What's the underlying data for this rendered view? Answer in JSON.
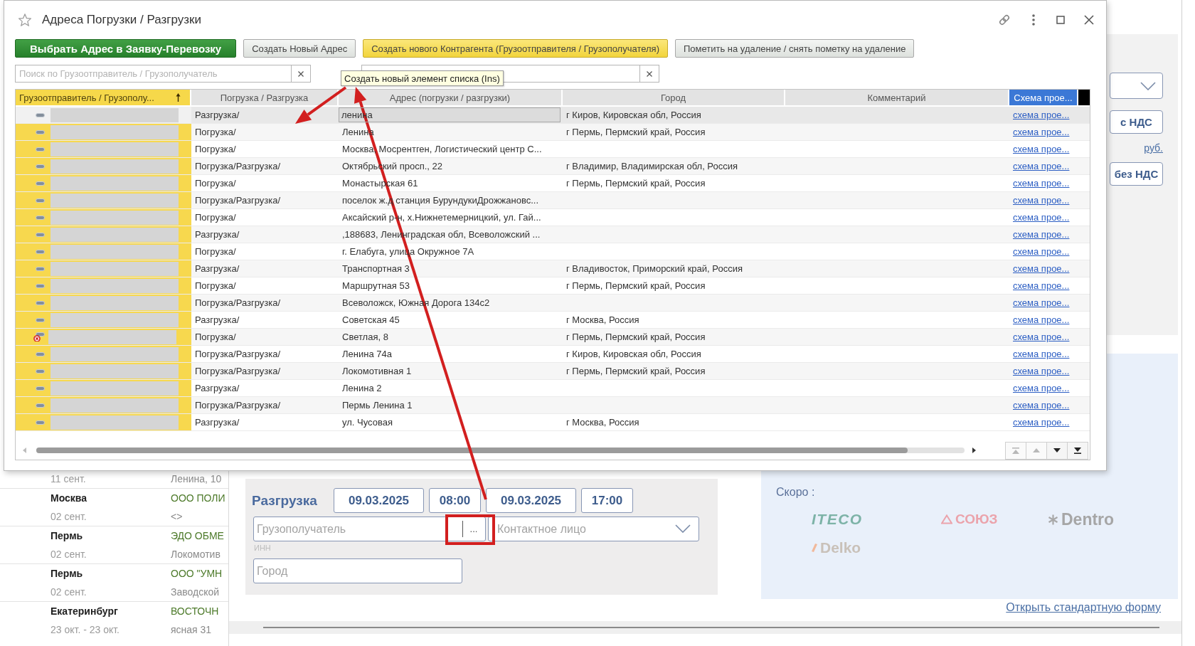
{
  "dialog": {
    "title": "Адреса Погрузки / Разгрузки",
    "favorite": false,
    "toolbar": [
      {
        "label": "Выбрать Адрес в Заявку-Перевозку",
        "kind": "primary"
      },
      {
        "label": "Создать Новый Адрес",
        "kind": "plain"
      },
      {
        "label": "Создать нового Контрагента (Грузоотправителя / Грузополучателя)",
        "kind": "accent"
      },
      {
        "label": "Пометить на удаление / снять пометку на удаление",
        "kind": "plain"
      }
    ],
    "search_fields": [
      {
        "placeholder": "Поиск по Грузоотправитель / Грузополучатель",
        "clear_button": true
      },
      {
        "clear_button": true
      }
    ],
    "tooltip": {
      "text": "Создать новый элемент списка (Ins)"
    },
    "table": {
      "columns": [
        {
          "label": "Грузоотправитель / Грузополу...",
          "kind": "name",
          "sorted": true,
          "highlighted": false
        },
        {
          "label": "Погрузка / Разгрузка",
          "kind": "type",
          "sorted": false,
          "highlighted": false
        },
        {
          "label": "Адрес (погрузки / разгрузки)",
          "kind": "address",
          "sorted": false,
          "highlighted": false
        },
        {
          "label": "Город",
          "kind": "city",
          "sorted": false,
          "highlighted": false
        },
        {
          "label": "Комментарий",
          "kind": "comment",
          "sorted": false,
          "highlighted": false
        },
        {
          "label": "Схема прое...",
          "kind": "link",
          "sorted": false,
          "highlighted": true
        }
      ],
      "rows": [
        {
          "selected": true,
          "marked_for_deletion": false,
          "operation": "Разгрузка/",
          "address": "ленина",
          "city": "г Киров, Кировская обл, Россия",
          "scheme_link": "схема прое..."
        },
        {
          "selected": false,
          "marked_for_deletion": false,
          "operation": "Погрузка/",
          "address": "Ленина",
          "city": "г Пермь, Пермский край, Россия",
          "scheme_link": "схема прое..."
        },
        {
          "selected": false,
          "marked_for_deletion": false,
          "operation": "Погрузка/",
          "address": "Москва, Мосрентген, Логистический центр С...",
          "scheme_link": "схема прое..."
        },
        {
          "selected": false,
          "marked_for_deletion": false,
          "operation": "Погрузка/Разгрузка/",
          "address": "Октябрьский просп., 22",
          "city": "г Владимир, Владимирская обл, Россия",
          "scheme_link": "схема прое..."
        },
        {
          "selected": false,
          "marked_for_deletion": false,
          "operation": "Погрузка/",
          "address": "Монастырская 61",
          "city": "г Пермь, Пермский край, Россия",
          "scheme_link": "схема прое..."
        },
        {
          "selected": false,
          "marked_for_deletion": false,
          "operation": "Погрузка/Разгрузка/",
          "address": "поселок ж.д станция БурундукиДрожжановс...",
          "scheme_link": "схема прое..."
        },
        {
          "selected": false,
          "marked_for_deletion": false,
          "operation": "Погрузка/",
          "address": "Аксайский р-н, х.Нижнетемерницкий, ул. Гай...",
          "scheme_link": "схема прое..."
        },
        {
          "selected": false,
          "marked_for_deletion": false,
          "operation": "Разгрузка/",
          "address": ",188683, Ленинградская обл, Всеволожский ...",
          "scheme_link": "схема прое..."
        },
        {
          "selected": false,
          "marked_for_deletion": false,
          "operation": "Погрузка/",
          "address": "г. Елабуга, улица Окружное 7А",
          "scheme_link": "схема прое..."
        },
        {
          "selected": false,
          "marked_for_deletion": false,
          "operation": "Разгрузка/",
          "address": "Транспортная 3",
          "city": "г Владивосток, Приморский край, Россия",
          "scheme_link": "схема прое..."
        },
        {
          "selected": false,
          "marked_for_deletion": false,
          "operation": "Погрузка/",
          "address": "Маршрутная 53",
          "city": "г Пермь, Пермский край, Россия",
          "scheme_link": "схема прое..."
        },
        {
          "selected": false,
          "marked_for_deletion": false,
          "operation": "Погрузка/Разгрузка/",
          "address": "Всеволожск, Южная Дорога 134с2",
          "scheme_link": "схема прое..."
        },
        {
          "selected": false,
          "marked_for_deletion": false,
          "operation": "Разгрузка/",
          "address": "Советская 45",
          "city": "г Москва, Россия",
          "scheme_link": "схема прое..."
        },
        {
          "selected": false,
          "marked_for_deletion": true,
          "operation": "Погрузка/",
          "address": "Светлая, 8",
          "city": "г Пермь, Пермский край, Россия",
          "scheme_link": "схема прое..."
        },
        {
          "selected": false,
          "marked_for_deletion": false,
          "operation": "Погрузка/Разгрузка/",
          "address": "Ленина 74а",
          "city": "г Киров, Кировская обл, Россия",
          "scheme_link": "схема прое..."
        },
        {
          "selected": false,
          "marked_for_deletion": false,
          "operation": "Погрузка/Разгрузка/",
          "address": "Локомотивная 1",
          "city": "г Пермь, Пермский край, Россия",
          "scheme_link": "схема прое..."
        },
        {
          "selected": false,
          "marked_for_deletion": false,
          "operation": "Разгрузка/",
          "address": "Ленина 2",
          "scheme_link": "схема прое..."
        },
        {
          "selected": false,
          "marked_for_deletion": false,
          "operation": "Погрузка/Разгрузка/",
          "address": "Пермь Ленина 1",
          "scheme_link": "схема прое..."
        },
        {
          "selected": false,
          "marked_for_deletion": false,
          "operation": "Разгрузка/",
          "address": "ул. Чусовая",
          "city": "г Москва, Россия",
          "scheme_link": "схема прое..."
        }
      ]
    },
    "navigation_buttons": [
      {
        "kind": "first",
        "disabled": true
      },
      {
        "kind": "up",
        "disabled": true
      },
      {
        "kind": "down",
        "disabled": false
      },
      {
        "kind": "last",
        "disabled": false
      }
    ]
  },
  "background": {
    "list": [
      {
        "date": "11 сент.",
        "address": "Ленина, 10"
      },
      {
        "city": "Москва",
        "company": "ООО ПОЛИ",
        "date": "02 сент.",
        "address": "<>"
      },
      {
        "city": "Пермь",
        "company": "ЭДО ОБМЕ",
        "date": "02 сент.",
        "address": "Локомотив"
      },
      {
        "city": "Пермь",
        "company": "ООО \"УМН",
        "date": "02 сент.",
        "address": "Заводской"
      },
      {
        "city": "Екатеринбург",
        "company": "ВОСТОЧН",
        "date": "23 окт. - 23 окт.",
        "address": "ясная 31"
      }
    ],
    "price_panel": {
      "controls": [
        {
          "label": "с НДС",
          "kind": "button"
        },
        {
          "label": "руб.",
          "kind": "link"
        },
        {
          "label": "без НДС",
          "kind": "button"
        }
      ]
    },
    "unloading": {
      "title": "Разгрузка",
      "datetime_fields": [
        {
          "kind": "date",
          "value": "09.03.2025"
        },
        {
          "kind": "time",
          "value": "08:00"
        },
        {
          "kind": "date",
          "value": "09.03.2025"
        },
        {
          "kind": "time",
          "value": "17:00"
        }
      ],
      "consignee": {
        "placeholder": "Грузополучатель",
        "choose_button": "..."
      },
      "contact": {
        "placeholder": "Контактное лицо"
      },
      "inn_label": "ИНН",
      "city": {
        "placeholder": "Город"
      }
    },
    "partners": {
      "label": "Скоро :",
      "logos": [
        {
          "name": "ITECO",
          "kind": "italic"
        },
        {
          "name": "СОЮЗ",
          "kind": "emblem"
        },
        {
          "name": "Dentro",
          "kind": "icon"
        },
        {
          "name": "Delko",
          "kind": "mark"
        }
      ]
    },
    "open_form_link": "Открыть стандартную форму"
  }
}
